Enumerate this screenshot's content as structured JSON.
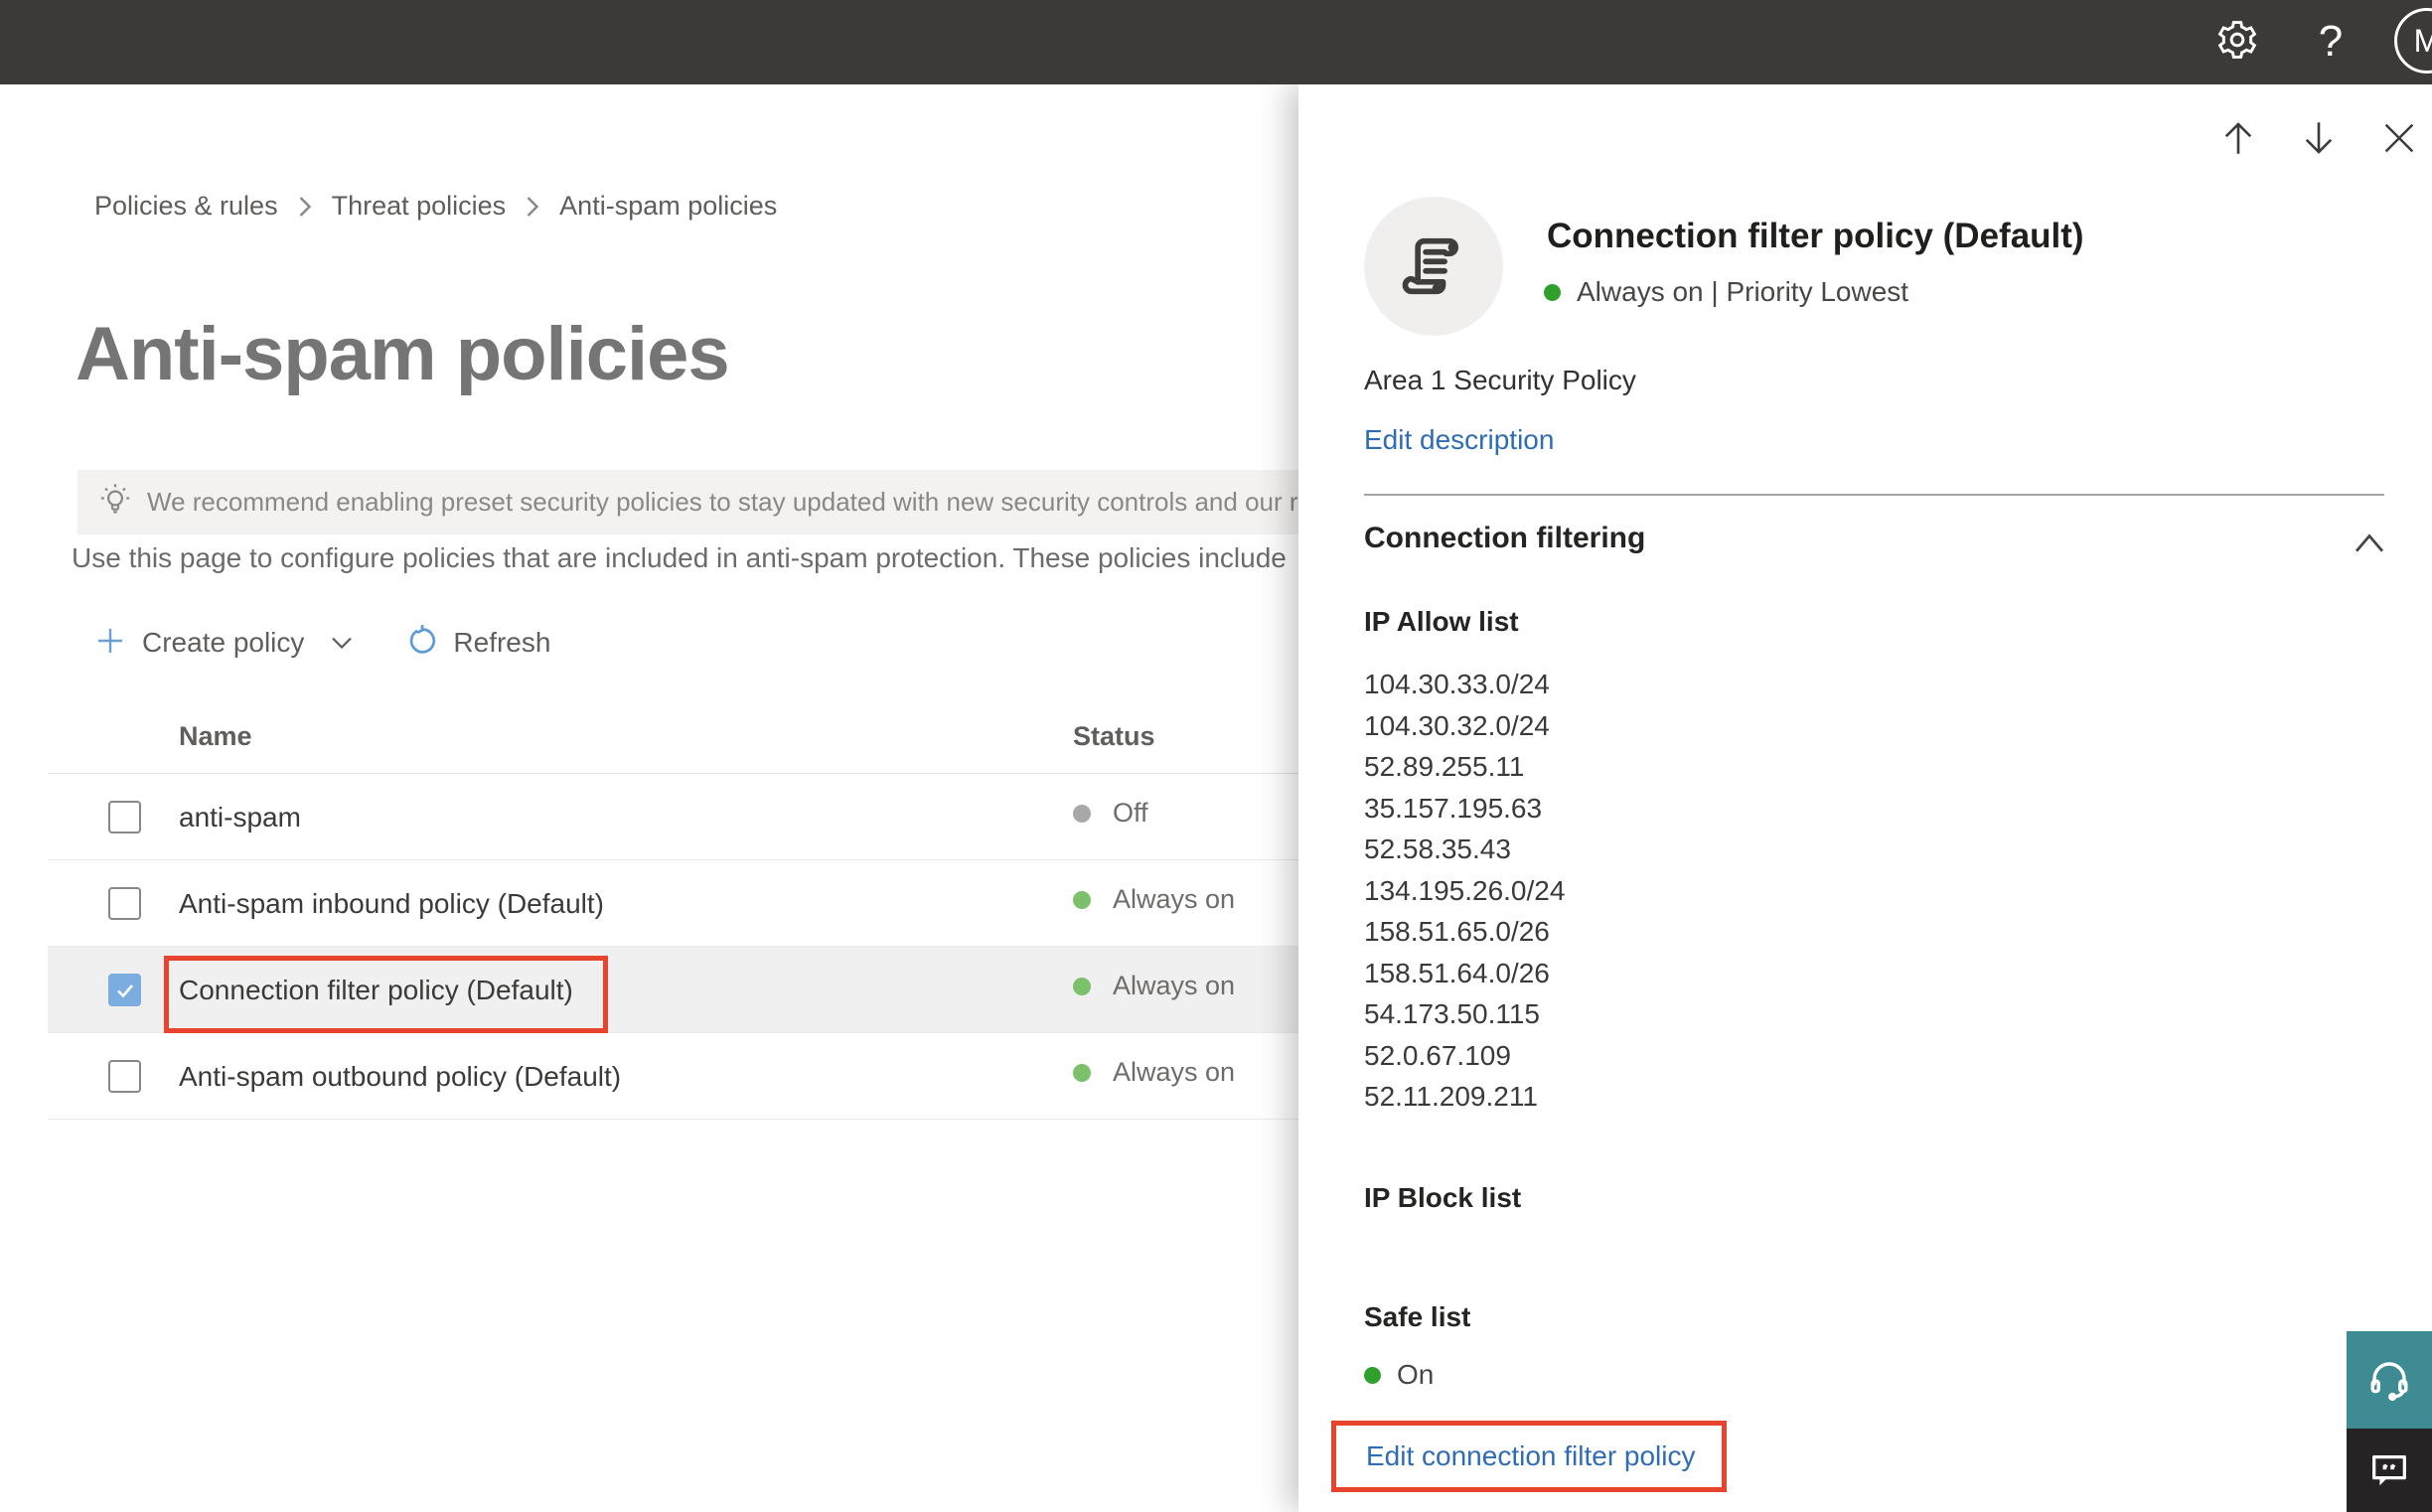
{
  "topbar": {
    "avatar_initial": "M"
  },
  "breadcrumb": {
    "items": [
      "Policies & rules",
      "Threat policies",
      "Anti-spam policies"
    ]
  },
  "page": {
    "title": "Anti-spam policies",
    "banner_text": "We recommend enabling preset security policies to stay updated with new security controls and our recomme",
    "intro_text": "Use this page to configure policies that are included in anti-spam protection. These policies include",
    "toolbar": {
      "create_label": "Create policy",
      "refresh_label": "Refresh"
    },
    "table": {
      "columns": [
        "Name",
        "Status"
      ],
      "rows": [
        {
          "name": "anti-spam",
          "status": "Off",
          "status_color": "gray"
        },
        {
          "name": "Anti-spam inbound policy (Default)",
          "status": "Always on",
          "status_color": "green"
        },
        {
          "name": "Connection filter policy (Default)",
          "status": "Always on",
          "status_color": "green"
        },
        {
          "name": "Anti-spam outbound policy (Default)",
          "status": "Always on",
          "status_color": "green"
        }
      ]
    }
  },
  "flyout": {
    "title": "Connection filter policy (Default)",
    "status_line": "Always on | Priority Lowest",
    "description": "Area 1 Security Policy",
    "edit_description_label": "Edit description",
    "section_title": "Connection filtering",
    "ip_allow": {
      "title": "IP Allow list",
      "items": [
        "104.30.33.0/24",
        "104.30.32.0/24",
        "52.89.255.11",
        "35.157.195.63",
        "52.58.35.43",
        "134.195.26.0/24",
        "158.51.65.0/26",
        "158.51.64.0/26",
        "54.173.50.115",
        "52.0.67.109",
        "52.11.209.211"
      ]
    },
    "ip_block": {
      "title": "IP Block list"
    },
    "safe_list": {
      "title": "Safe list",
      "value": "On"
    },
    "edit_link_label": "Edit connection filter policy"
  },
  "colors": {
    "topbar_bg": "#3b3a39",
    "annotation_red": "#e8432d",
    "status_green_table": "#7cc06c",
    "status_green_bright": "#2fa02c",
    "status_gray": "#a8a8a8",
    "link_blue": "#2e6db6",
    "checkbox_blue": "#7cade0",
    "toolbar_icon_blue": "#5b9bd5",
    "support_teal": "#3f8b94",
    "chat_dark": "#252323",
    "selected_row_bg": "#f1f0f0",
    "banner_bg": "#f3f2f1"
  }
}
